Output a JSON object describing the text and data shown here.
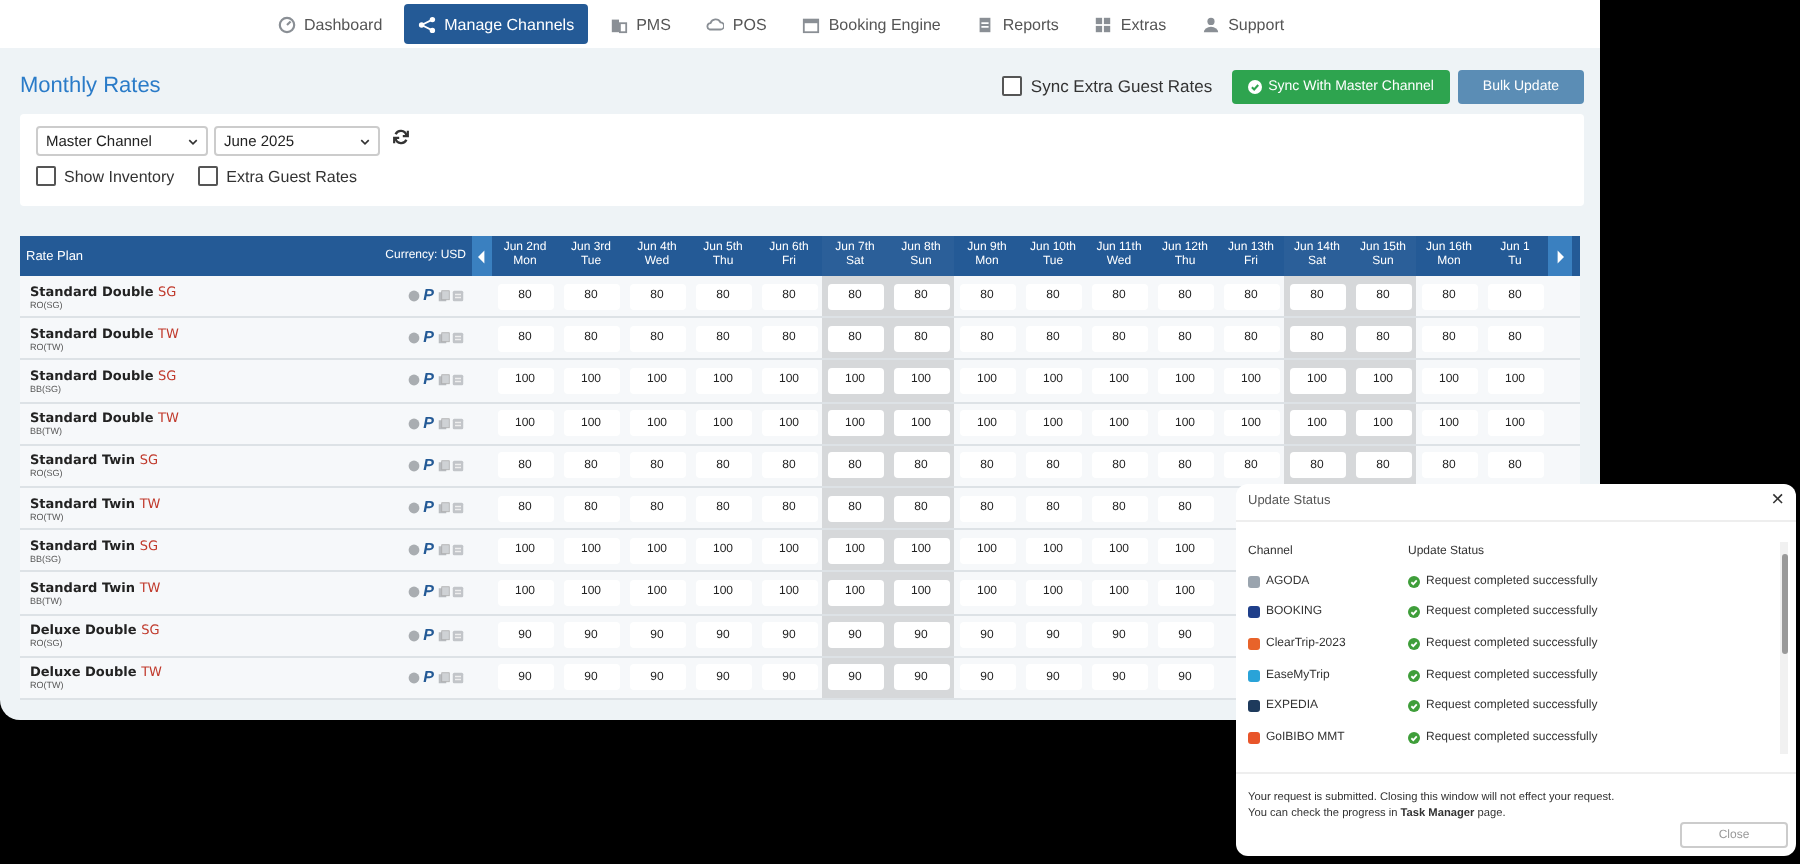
{
  "nav": [
    {
      "label": "Dashboard",
      "kind": "dial",
      "selected": false
    },
    {
      "label": "Manage Channels",
      "kind": "share",
      "selected": true
    },
    {
      "label": "PMS",
      "kind": "building",
      "selected": false
    },
    {
      "label": "POS",
      "kind": "cloud",
      "selected": false
    },
    {
      "label": "Booking Engine",
      "kind": "calendar",
      "selected": false
    },
    {
      "label": "Reports",
      "kind": "doc",
      "selected": false
    },
    {
      "label": "Extras",
      "kind": "grid",
      "selected": false
    },
    {
      "label": "Support",
      "kind": "person",
      "selected": false
    }
  ],
  "page_title": "Monthly Rates",
  "sync_extra": {
    "label": "Sync Extra Guest Rates",
    "checked": false
  },
  "sync_button": "Sync With Master Channel",
  "bulk_button": "Bulk Update",
  "filters": {
    "channel": "Master Channel",
    "month": "June 2025",
    "show_inventory": {
      "label": "Show Inventory",
      "checked": false
    },
    "extra_guest": {
      "label": "Extra Guest Rates",
      "checked": false
    }
  },
  "table": {
    "plan_header": "Rate Plan",
    "currency": "Currency: USD",
    "columns": [
      {
        "date": "Jun 2nd",
        "day": "Mon",
        "weekend": false
      },
      {
        "date": "Jun 3rd",
        "day": "Tue",
        "weekend": false
      },
      {
        "date": "Jun 4th",
        "day": "Wed",
        "weekend": false
      },
      {
        "date": "Jun 5th",
        "day": "Thu",
        "weekend": false
      },
      {
        "date": "Jun 6th",
        "day": "Fri",
        "weekend": false
      },
      {
        "date": "Jun 7th",
        "day": "Sat",
        "weekend": true
      },
      {
        "date": "Jun 8th",
        "day": "Sun",
        "weekend": true
      },
      {
        "date": "Jun 9th",
        "day": "Mon",
        "weekend": false
      },
      {
        "date": "Jun 10th",
        "day": "Tue",
        "weekend": false
      },
      {
        "date": "Jun 11th",
        "day": "Wed",
        "weekend": false
      },
      {
        "date": "Jun 12th",
        "day": "Thu",
        "weekend": false
      },
      {
        "date": "Jun 13th",
        "day": "Fri",
        "weekend": false
      },
      {
        "date": "Jun 14th",
        "day": "Sat",
        "weekend": true
      },
      {
        "date": "Jun 15th",
        "day": "Sun",
        "weekend": true
      },
      {
        "date": "Jun 16th",
        "day": "Mon",
        "weekend": false
      },
      {
        "date": "Jun 1",
        "day": "Tu",
        "weekend": false
      }
    ],
    "rows": [
      {
        "name": "Standard Double",
        "tag": "SG",
        "code": "RO(SG)",
        "badge": "P",
        "rates": [
          "80",
          "80",
          "80",
          "80",
          "80",
          "80",
          "80",
          "80",
          "80",
          "80",
          "80",
          "80",
          "80",
          "80",
          "80",
          "80"
        ]
      },
      {
        "name": "Standard Double",
        "tag": "TW",
        "code": "RO(TW)",
        "badge": "P",
        "rates": [
          "80",
          "80",
          "80",
          "80",
          "80",
          "80",
          "80",
          "80",
          "80",
          "80",
          "80",
          "80",
          "80",
          "80",
          "80",
          "80"
        ]
      },
      {
        "name": "Standard Double",
        "tag": "SG",
        "code": "BB(SG)",
        "badge": "P",
        "rates": [
          "100",
          "100",
          "100",
          "100",
          "100",
          "100",
          "100",
          "100",
          "100",
          "100",
          "100",
          "100",
          "100",
          "100",
          "100",
          "100"
        ]
      },
      {
        "name": "Standard Double",
        "tag": "TW",
        "code": "BB(TW)",
        "badge": "P",
        "rates": [
          "100",
          "100",
          "100",
          "100",
          "100",
          "100",
          "100",
          "100",
          "100",
          "100",
          "100",
          "100",
          "100",
          "100",
          "100",
          "100"
        ]
      },
      {
        "name": "Standard Twin",
        "tag": "SG",
        "code": "RO(SG)",
        "badge": "P",
        "rates": [
          "80",
          "80",
          "80",
          "80",
          "80",
          "80",
          "80",
          "80",
          "80",
          "80",
          "80",
          "80",
          "80",
          "80",
          "80",
          "80"
        ]
      },
      {
        "name": "Standard Twin",
        "tag": "TW",
        "code": "RO(TW)",
        "badge": "P",
        "rates": [
          "80",
          "80",
          "80",
          "80",
          "80",
          "80",
          "80",
          "80",
          "80",
          "80",
          "80"
        ]
      },
      {
        "name": "Standard Twin",
        "tag": "SG",
        "code": "BB(SG)",
        "badge": "P",
        "rates": [
          "100",
          "100",
          "100",
          "100",
          "100",
          "100",
          "100",
          "100",
          "100",
          "100",
          "100"
        ]
      },
      {
        "name": "Standard Twin",
        "tag": "TW",
        "code": "BB(TW)",
        "badge": "P",
        "rates": [
          "100",
          "100",
          "100",
          "100",
          "100",
          "100",
          "100",
          "100",
          "100",
          "100",
          "100"
        ]
      },
      {
        "name": "Deluxe Double",
        "tag": "SG",
        "code": "RO(SG)",
        "badge": "P",
        "rates": [
          "90",
          "90",
          "90",
          "90",
          "90",
          "90",
          "90",
          "90",
          "90",
          "90",
          "90"
        ]
      },
      {
        "name": "Deluxe Double",
        "tag": "TW",
        "code": "RO(TW)",
        "badge": "P",
        "rates": [
          "90",
          "90",
          "90",
          "90",
          "90",
          "90",
          "90",
          "90",
          "90",
          "90",
          "90"
        ]
      }
    ]
  },
  "dialog": {
    "title": "Update Status",
    "close_glyph": "×",
    "channel_header": "Channel",
    "status_header": "Update Status",
    "channels": [
      {
        "name": "AGODA",
        "color": "#9aa4ae",
        "status": "Request completed successfully"
      },
      {
        "name": "BOOKING",
        "color": "#1f3f8a",
        "status": "Request completed successfully"
      },
      {
        "name": "ClearTrip-2023",
        "color": "#e8632a",
        "status": "Request completed successfully"
      },
      {
        "name": "EaseMyTrip",
        "color": "#2aa3d8",
        "status": "Request completed successfully"
      },
      {
        "name": "EXPEDIA",
        "color": "#1e3a5c",
        "status": "Request completed successfully"
      },
      {
        "name": "GoIBIBO MMT",
        "color": "#e8552a",
        "status": "Request completed successfully"
      }
    ],
    "note": "Your request is submitted. Closing this window will not effect your request.\nYou can check the progress in **Task Manager** page.",
    "close_button": "Close"
  }
}
